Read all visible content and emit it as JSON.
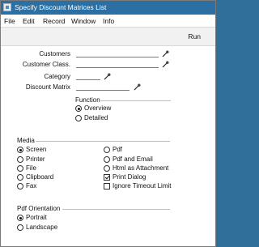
{
  "window": {
    "title": "Specify Discount Matrices List"
  },
  "menu": {
    "file": "File",
    "edit": "Edit",
    "record": "Record",
    "window": "Window",
    "info": "Info"
  },
  "toolbar": {
    "run_label": "Run"
  },
  "fields": {
    "customers": {
      "label": "Customers",
      "value": ""
    },
    "customer_class": {
      "label": "Customer Class.",
      "value": ""
    },
    "category": {
      "label": "Category",
      "value": ""
    },
    "discount_matrix": {
      "label": "Discount Matrix",
      "value": ""
    }
  },
  "function": {
    "title": "Function",
    "options": [
      {
        "label": "Overview",
        "selected": true
      },
      {
        "label": "Detailed",
        "selected": false
      }
    ]
  },
  "media": {
    "title": "Media",
    "options": [
      {
        "label": "Screen",
        "selected": true
      },
      {
        "label": "Printer",
        "selected": false
      },
      {
        "label": "File",
        "selected": false
      },
      {
        "label": "Clipboard",
        "selected": false
      },
      {
        "label": "Fax",
        "selected": false
      },
      {
        "label": "Pdf",
        "selected": false
      },
      {
        "label": "Pdf and Email",
        "selected": false
      },
      {
        "label": "Html as Attachment",
        "selected": false
      }
    ],
    "checks": [
      {
        "label": "Print Dialog",
        "checked": true
      },
      {
        "label": "Ignore Timeout Limit",
        "checked": false
      }
    ]
  },
  "pdf_orientation": {
    "title": "Pdf Orientation",
    "options": [
      {
        "label": "Portrait",
        "selected": true
      },
      {
        "label": "Landscape",
        "selected": false
      }
    ]
  },
  "icons": {
    "paste": "paste-special-icon",
    "app": "app-window-icon"
  },
  "colors": {
    "titlebar": "#2c6fa3",
    "window_bg": "#ffffff",
    "toolbar_bg": "#f1f1f1"
  }
}
